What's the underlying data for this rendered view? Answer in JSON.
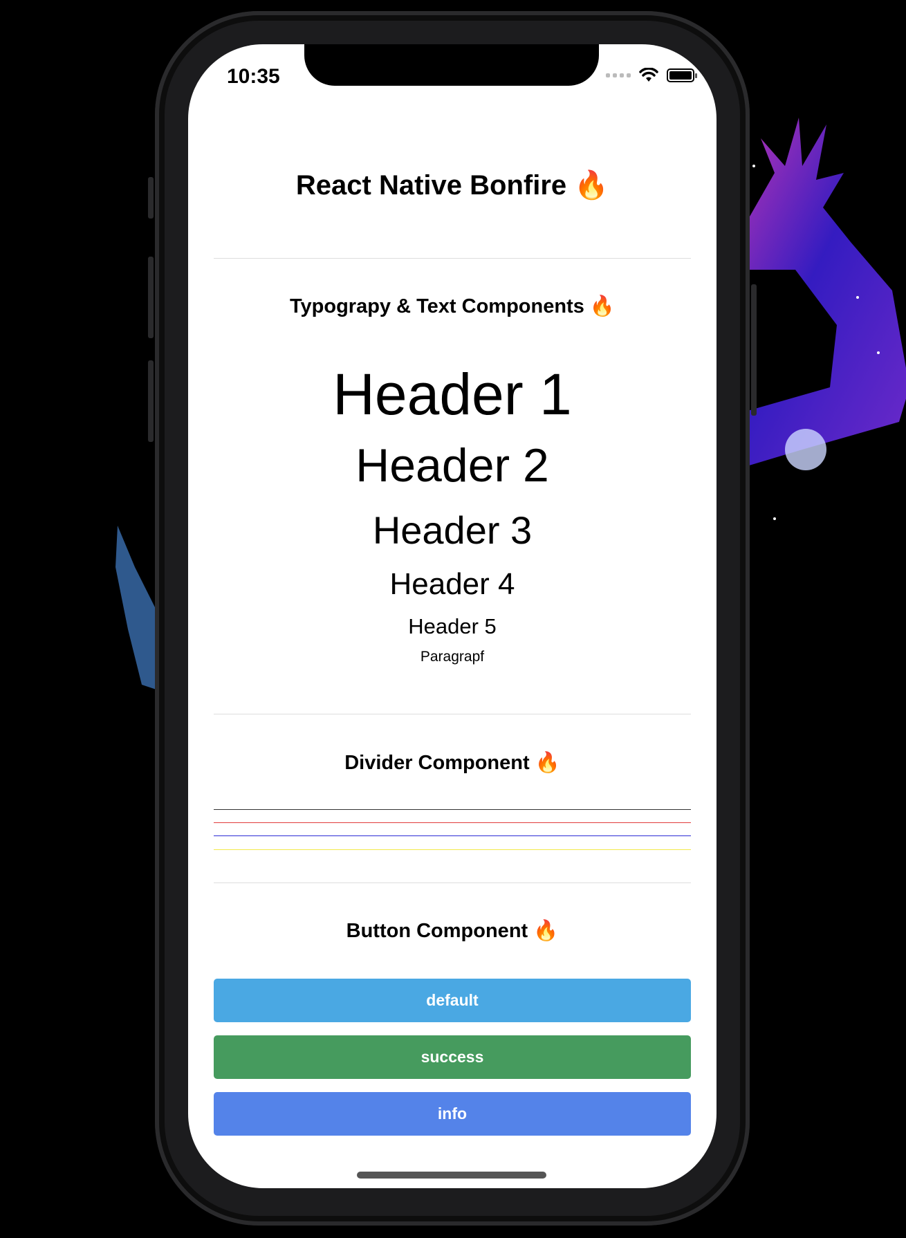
{
  "status_bar": {
    "time": "10:35"
  },
  "app_title": "React Native Bonfire 🔥",
  "typography": {
    "section_title": "Typograpy & Text Components 🔥",
    "h1": "Header 1",
    "h2": "Header 2",
    "h3": "Header 3",
    "h4": "Header 4",
    "h5": "Header 5",
    "paragraph": "Paragrapf"
  },
  "divider": {
    "section_title": "Divider Component 🔥",
    "colors": [
      "#333333",
      "#e23b3b",
      "#2b2bd6",
      "#f2e94a"
    ]
  },
  "buttons": {
    "section_title": "Button Component 🔥",
    "items": [
      {
        "label": "default",
        "color": "#4aa8e3"
      },
      {
        "label": "success",
        "color": "#469b5e"
      },
      {
        "label": "info",
        "color": "#5483e9"
      }
    ]
  }
}
